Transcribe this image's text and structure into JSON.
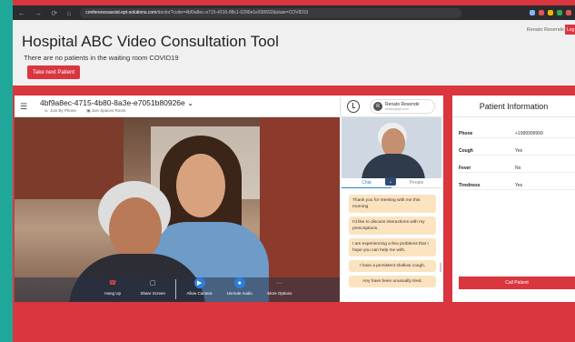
{
  "browser": {
    "url_host": "conferenceassist.ept-solutions.com",
    "url_path": "/doctor?code=4bf9a8ec-e715-4316-88c1-0290e1e930692&state=COVID19"
  },
  "header": {
    "title": "Hospital ABC Video Consultation Tool",
    "subtitle": "There are no patients in the waiting room COVID19",
    "next_button": "Take next Patient",
    "user_name": "Renato Resende",
    "logout": "Log"
  },
  "call": {
    "room_id": "4bf9a8ec-4715-4b80-8a3e-e7051b80926e ⌄",
    "join_by_phone": "Join By Phone",
    "join_spaces": "Join Spaces Room",
    "user_initial": "R",
    "user_name": "Renato Resende",
    "user_email": "renato@ept.com",
    "controls": [
      {
        "label": "Hang Up",
        "icon": "☎"
      },
      {
        "label": "Share Screen",
        "icon": "▢"
      },
      {
        "label": "Allow Camera",
        "icon": "▶"
      },
      {
        "label": "Unmute Audio",
        "icon": "●"
      },
      {
        "label": "More Options",
        "icon": "···"
      }
    ],
    "tabs": {
      "chat": "Chat",
      "people": "People"
    },
    "messages": [
      "Thank you for meeting  with me this morning",
      "I'd like to discuss interactions with my prescriptions.",
      "I am experiencing a few problems that I hope you can help me with.",
      "I have a persistent shallow cough.",
      "Any have been unusually tired."
    ]
  },
  "patient": {
    "title": "Patient Information",
    "rows": [
      {
        "key": "Phone",
        "value": "+1999999999"
      },
      {
        "key": "Cough",
        "value": "Yes"
      },
      {
        "key": "Fever",
        "value": "No"
      },
      {
        "key": "Tiredness",
        "value": "Yes"
      }
    ],
    "call_button": "Call Patient"
  }
}
